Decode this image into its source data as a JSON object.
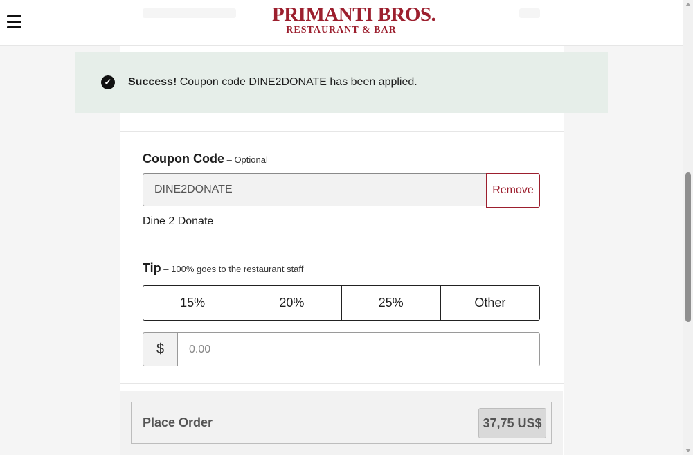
{
  "header": {
    "logo_main": "PRIMANTI BROS.",
    "logo_sub": "RESTAURANT & BAR"
  },
  "banner": {
    "strong": "Success!",
    "message": " Coupon code DINE2DONATE has been applied."
  },
  "coupon": {
    "title": "Coupon Code",
    "note": " – Optional",
    "value": "DINE2DONATE",
    "remove_label": "Remove",
    "name": "Dine 2 Donate"
  },
  "tip": {
    "title": "Tip",
    "note": " – 100% goes to the restaurant staff",
    "options": [
      "15%",
      "20%",
      "25%",
      "Other"
    ],
    "currency_symbol": "$",
    "placeholder": "0.00"
  },
  "order": {
    "label": "Place Order",
    "price": "37,75 US$"
  },
  "colors": {
    "brand": "#9c1f2e",
    "success_bg": "#e6eee9"
  }
}
